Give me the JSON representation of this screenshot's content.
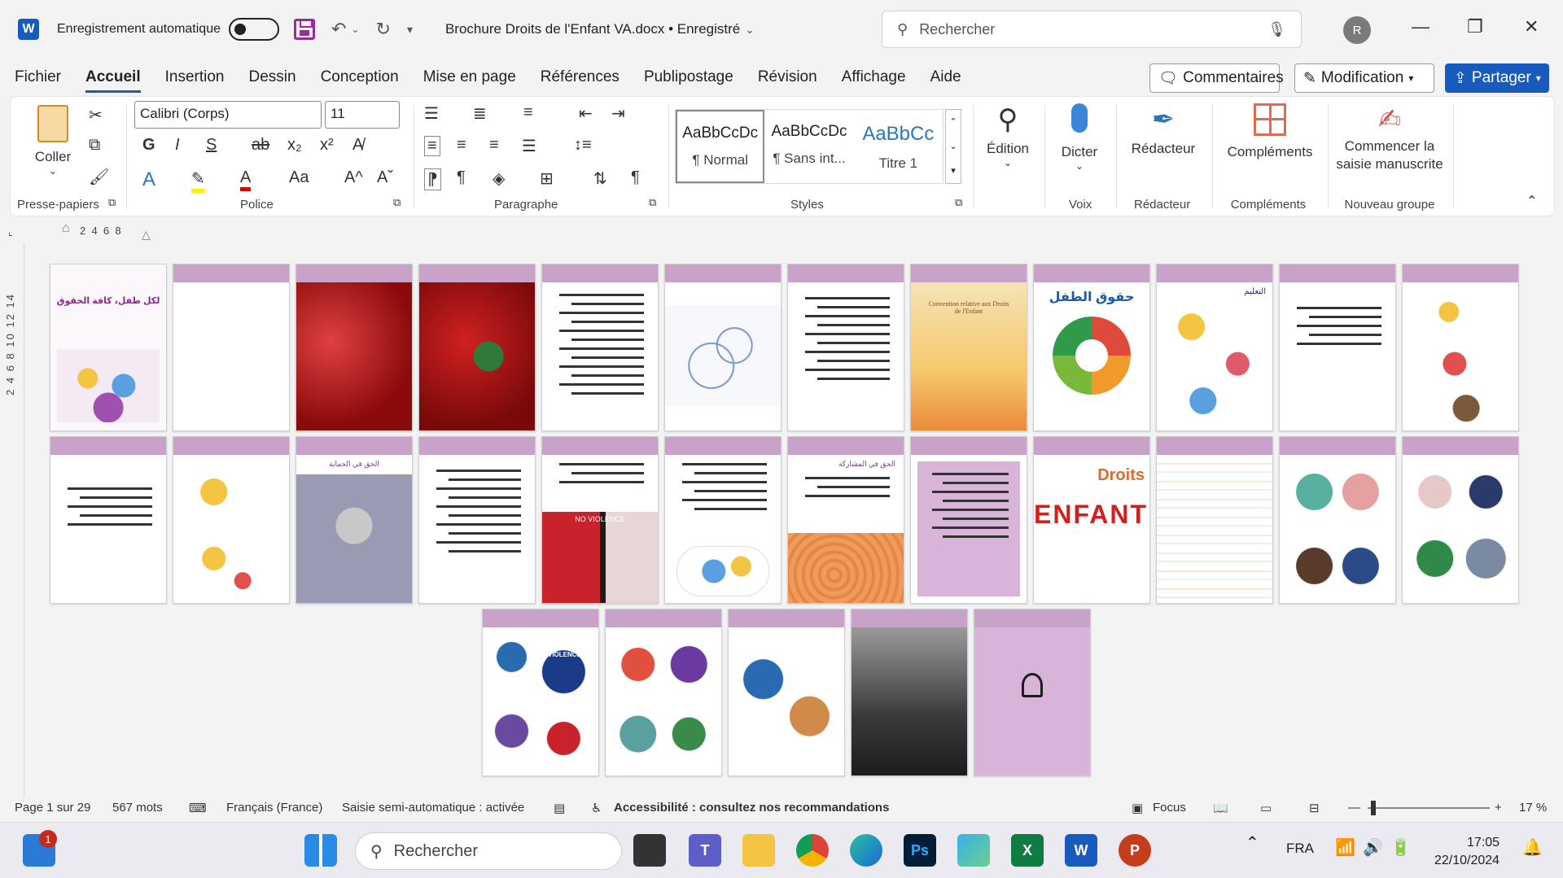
{
  "app": {
    "autosave_label": "Enregistrement automatique",
    "doc_title": "Brochure Droits de l'Enfant VA.docx • Enregistré",
    "search_placeholder": "Rechercher",
    "avatar_initial": "R"
  },
  "menu": {
    "items": [
      "Fichier",
      "Accueil",
      "Insertion",
      "Dessin",
      "Conception",
      "Mise en page",
      "Références",
      "Publipostage",
      "Révision",
      "Affichage",
      "Aide"
    ],
    "active": "Accueil",
    "comments": "Commentaires",
    "editing": "Modification",
    "share": "Partager"
  },
  "ribbon": {
    "paste": "Coller",
    "clipboard_group": "Presse-papiers",
    "font_name": "Calibri (Corps)",
    "font_size": "11",
    "font_group": "Police",
    "paragraph_group": "Paragraphe",
    "styles_group": "Styles",
    "styles": [
      {
        "preview": "AaBbCcDc",
        "name": "¶ Normal"
      },
      {
        "preview": "AaBbCcDc",
        "name": "¶ Sans int..."
      },
      {
        "preview": "AaBbCc",
        "name": "Titre 1"
      }
    ],
    "edition": "Édition",
    "dictate": "Dicter",
    "voice_group": "Voix",
    "editor": "Rédacteur",
    "editor_group": "Rédacteur",
    "addins": "Compléments",
    "addins_group": "Compléments",
    "ink": "Commencer la saisie manuscrite",
    "new_group": "Nouveau groupe"
  },
  "ruler": {
    "h_ticks": "2  4  6  8",
    "v_ticks": "2  4  6  8 10 12 14"
  },
  "pages": {
    "title_page": "لكل طفل، كافة الحقوق",
    "rights_title": "حقوق الطفل",
    "convention": "Convention relative aux Droits de l'Enfant",
    "education": "التعليم",
    "protection": "الحق في الحماية",
    "no_violence": "NO VIOLENCE",
    "participation": "الحق في المشاركة",
    "enfant_word": "ENFANT",
    "droits_word": "Droits",
    "end_violence": "END VIOLENCE"
  },
  "status": {
    "page": "Page 1 sur 29",
    "words": "567 mots",
    "language": "Français (France)",
    "autosave": "Saisie semi-automatique : activée",
    "accessibility": "Accessibilité : consultez nos recommandations",
    "focus": "Focus",
    "zoom": "17 %"
  },
  "taskbar": {
    "search": "Rechercher",
    "lang": "FRA",
    "time": "17:05",
    "date": "22/10/2024",
    "notifications": "1"
  }
}
